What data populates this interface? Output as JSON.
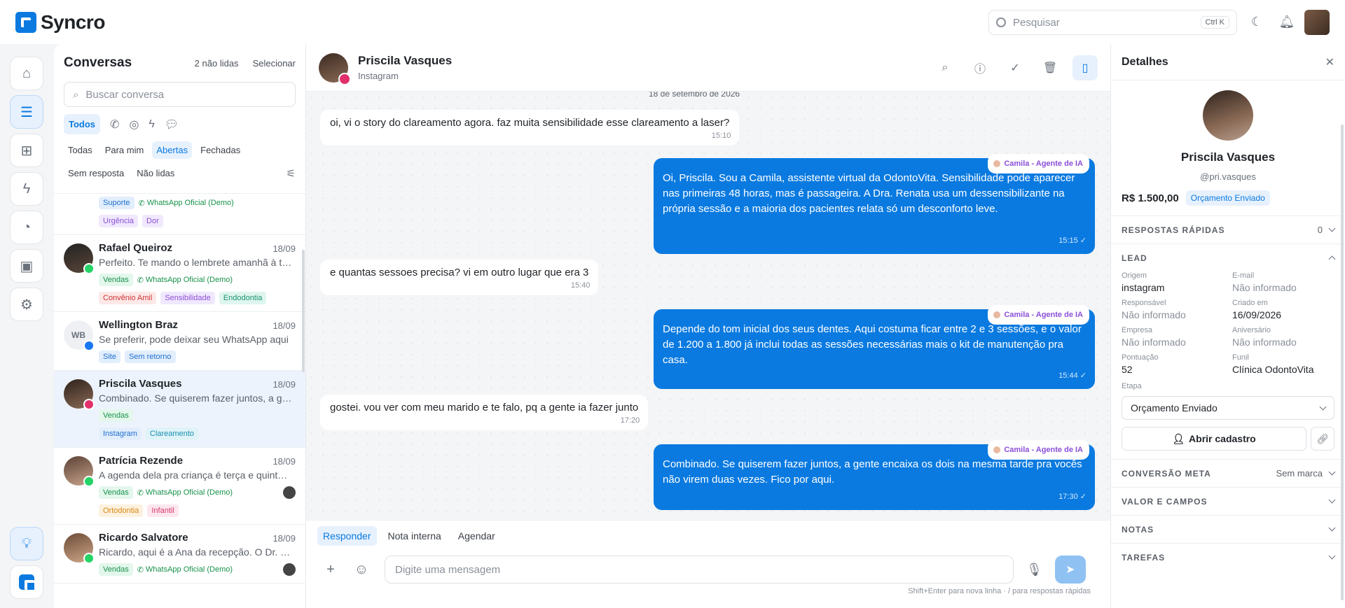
{
  "app": {
    "name": "Syncro",
    "search_placeholder": "Pesquisar",
    "search_shortcut": "Ctrl K"
  },
  "conversations": {
    "title": "Conversas",
    "unread": "2 não lidas",
    "select": "Selecionar",
    "search_placeholder": "Buscar conversa",
    "channel_all": "Todos",
    "filters": [
      "Todas",
      "Para mim",
      "Abertas",
      "Fechadas"
    ],
    "filters2": [
      "Sem resposta",
      "Não lidas"
    ],
    "partial": {
      "tags": [
        "Suporte",
        "WhatsApp Oficial (Demo)"
      ],
      "tags2": [
        "Urgência",
        "Dor"
      ]
    },
    "items": [
      {
        "name": "Rafael Queiroz",
        "date": "18/09",
        "preview": "Perfeito. Te mando o lembrete amanhã à tarde",
        "tag1": "Vendas",
        "channel": "WhatsApp Oficial (Demo)",
        "tags": [
          "Convênio Amil",
          "Sensibilidade",
          "Endodontia"
        ]
      },
      {
        "name": "Wellington Braz",
        "initials": "WB",
        "date": "18/09",
        "preview": "Se preferir, pode deixar seu WhatsApp aqui",
        "tags": [
          "Site",
          "Sem retorno"
        ]
      },
      {
        "name": "Priscila Vasques",
        "date": "18/09",
        "preview": "Combinado. Se quiserem fazer juntos, a gente encaixa",
        "tag1": "Vendas",
        "tags": [
          "Instagram",
          "Clareamento"
        ]
      },
      {
        "name": "Patrícia Rezende",
        "date": "18/09",
        "preview": "A agenda dela pra criança é terça e quinta à tarde",
        "tag1": "Vendas",
        "channel": "WhatsApp Oficial (Demo)",
        "tags": [
          "Ortodontia",
          "Infantil"
        ]
      },
      {
        "name": "Ricardo Salvatore",
        "date": "18/09",
        "preview": "Ricardo, aqui é a Ana da recepção. O Dr. Paulo",
        "tag1": "Vendas",
        "channel": "WhatsApp Oficial (Demo)"
      }
    ]
  },
  "chat": {
    "name": "Priscila Vasques",
    "channel": "Instagram",
    "date_chip": "18 de setembro de 2026",
    "agent_label": "Camila - Agente de IA",
    "messages": [
      {
        "text": "oi, vi o story do clareamento agora. faz muita sensibilidade esse clareamento a laser?",
        "time": "15:10"
      },
      {
        "text": "Oi, Priscila. Sou a Camila, assistente virtual da OdontoVita. Sensibilidade pode aparecer nas primeiras 48 horas, mas é passageira. A Dra. Renata usa um dessensibilizante na própria sessão e a maioria dos pacientes relata só um desconforto leve.",
        "time": "15:15 ✓"
      },
      {
        "text": "e quantas sessoes precisa? vi em outro lugar que era 3",
        "time": "15:40"
      },
      {
        "text": "Depende do tom inicial dos seus dentes. Aqui costuma ficar entre 2 e 3 sessões, e o valor de 1.200 a 1.800 já inclui todas as sessões necessárias mais o kit de manutenção pra casa.",
        "time": "15:44 ✓"
      },
      {
        "text": "gostei. vou ver com meu marido e te falo, pq a gente ia fazer junto",
        "time": "17:20"
      },
      {
        "text": "Combinado. Se quiserem fazer juntos, a gente encaixa os dois na mesma tarde pra vocês não virem duas vezes. Fico por aqui.",
        "time": "17:30 ✓"
      }
    ],
    "reply_tabs": [
      "Responder",
      "Nota interna",
      "Agendar"
    ],
    "input_placeholder": "Digite uma mensagem",
    "hint": "Shift+Enter para nova linha · / para respostas rápidas"
  },
  "details": {
    "title": "Detalhes",
    "name": "Priscila Vasques",
    "handle": "@pri.vasques",
    "price": "R$ 1.500,00",
    "stage": "Orçamento Enviado",
    "quick_replies": {
      "label": "RESPOSTAS RÁPIDAS",
      "count": "0"
    },
    "lead_label": "LEAD",
    "fields": [
      {
        "label": "Origem",
        "value": "instagram"
      },
      {
        "label": "E-mail",
        "value": "Não informado"
      },
      {
        "label": "Responsável",
        "value": "Não informado"
      },
      {
        "label": "Criado em",
        "value": "16/09/2026"
      },
      {
        "label": "Empresa",
        "value": "Não informado"
      },
      {
        "label": "Aniversário",
        "value": "Não informado"
      },
      {
        "label": "Pontuação",
        "value": "52"
      },
      {
        "label": "Funil",
        "value": "Clínica OdontoVita"
      }
    ],
    "etapa_label": "Etapa",
    "etapa_value": "Orçamento Enviado",
    "open_button": "Abrir cadastro",
    "sections": [
      {
        "label": "CONVERSÃO META",
        "right": "Sem marca"
      },
      {
        "label": "VALOR E CAMPOS",
        "right": ""
      },
      {
        "label": "NOTAS",
        "right": ""
      },
      {
        "label": "TAREFAS",
        "right": ""
      }
    ]
  }
}
